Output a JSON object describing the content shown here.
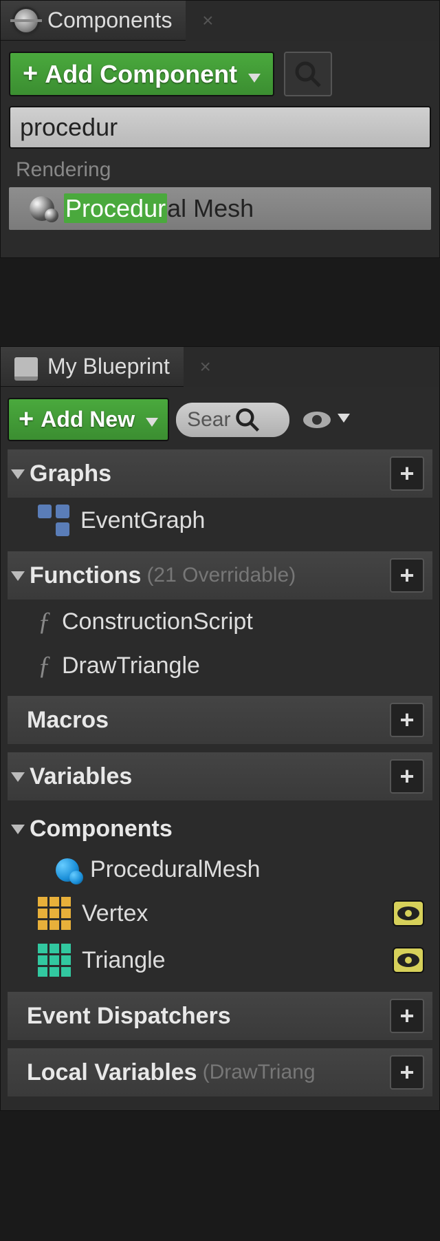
{
  "components_panel": {
    "title": "Components",
    "add_button": "Add Component",
    "search_value": "procedur",
    "category": "Rendering",
    "result": {
      "match": "Procedur",
      "rest": "al Mesh"
    }
  },
  "blueprint_panel": {
    "title": "My Blueprint",
    "add_button": "Add New",
    "search_placeholder": "Sear",
    "sections": {
      "graphs": {
        "label": "Graphs",
        "items": [
          "EventGraph"
        ]
      },
      "functions": {
        "label": "Functions",
        "note": "(21 Overridable)",
        "items": [
          "ConstructionScript",
          "DrawTriangle"
        ]
      },
      "macros": {
        "label": "Macros"
      },
      "variables": {
        "label": "Variables"
      },
      "components": {
        "label": "Components",
        "items": [
          "ProceduralMesh",
          "Vertex",
          "Triangle"
        ]
      },
      "event_dispatchers": {
        "label": "Event Dispatchers"
      },
      "local_variables": {
        "label": "Local Variables",
        "note": "(DrawTriang"
      }
    }
  }
}
